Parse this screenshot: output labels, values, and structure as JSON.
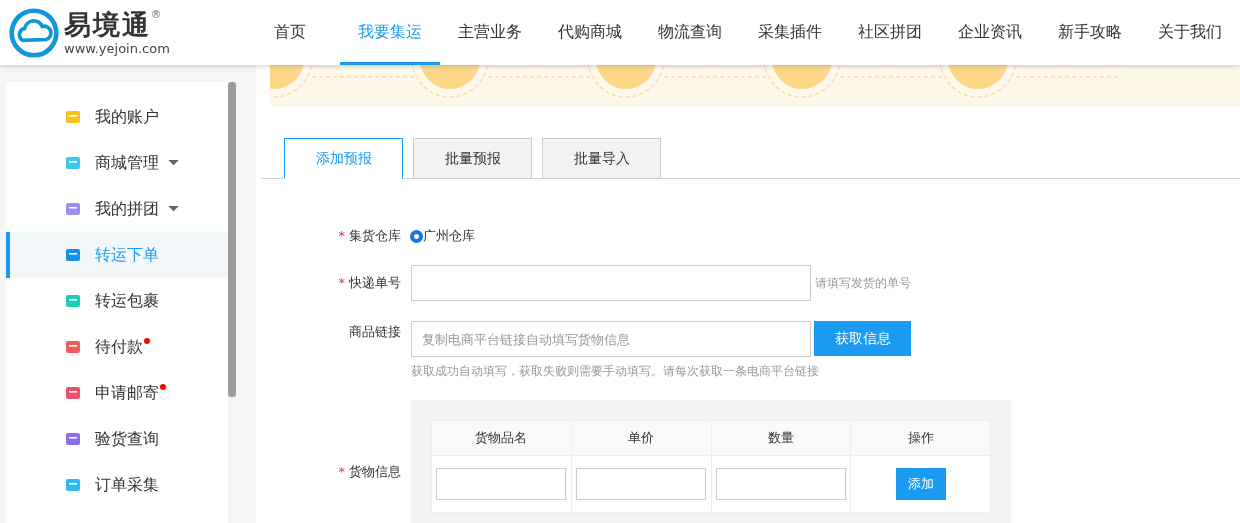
{
  "logo": {
    "name": "易境通",
    "registered": "®",
    "url": "www.yejoin.com"
  },
  "nav": [
    {
      "label": "首页",
      "selected": false
    },
    {
      "label": "我要集运",
      "selected": true
    },
    {
      "label": "主营业务",
      "selected": false
    },
    {
      "label": "代购商城",
      "selected": false
    },
    {
      "label": "物流查询",
      "selected": false
    },
    {
      "label": "采集插件",
      "selected": false
    },
    {
      "label": "社区拼团",
      "selected": false
    },
    {
      "label": "企业资讯",
      "selected": false
    },
    {
      "label": "新手攻略",
      "selected": false
    },
    {
      "label": "关于我们",
      "selected": false
    }
  ],
  "sidebar": {
    "items": [
      {
        "label": "我的账户",
        "selected": false,
        "expandable": false,
        "badge": false
      },
      {
        "label": "商城管理",
        "selected": false,
        "expandable": true,
        "badge": false
      },
      {
        "label": "我的拼团",
        "selected": false,
        "expandable": true,
        "badge": false
      },
      {
        "label": "转运下单",
        "selected": true,
        "expandable": false,
        "badge": false
      },
      {
        "label": "转运包裹",
        "selected": false,
        "expandable": false,
        "badge": false
      },
      {
        "label": "待付款",
        "selected": false,
        "expandable": false,
        "badge": true
      },
      {
        "label": "申请邮寄",
        "selected": false,
        "expandable": false,
        "badge": true
      },
      {
        "label": "验货查询",
        "selected": false,
        "expandable": false,
        "badge": false
      },
      {
        "label": "订单采集",
        "selected": false,
        "expandable": false,
        "badge": false
      }
    ]
  },
  "tabs": [
    {
      "label": "添加预报",
      "selected": true
    },
    {
      "label": "批量预报",
      "selected": false
    },
    {
      "label": "批量导入",
      "selected": false
    }
  ],
  "form": {
    "warehouse": {
      "required_mark": "*",
      "label": "集货仓库",
      "option": {
        "label": "广州仓库",
        "selected": true
      }
    },
    "tracking": {
      "required_mark": "*",
      "label": "快递单号",
      "hint": "请填写发货的单号"
    },
    "link": {
      "label": "商品链接",
      "placeholder": "复制电商平台链接自动填写货物信息",
      "button": "获取信息",
      "hint": "获取成功自动填写，获取失败则需要手动填写。请每次获取一条电商平台链接"
    },
    "goods": {
      "required_mark": "*",
      "label": "货物信息",
      "columns": [
        "货物品名",
        "单价",
        "数量",
        "操作"
      ],
      "action_button": "添加"
    }
  }
}
